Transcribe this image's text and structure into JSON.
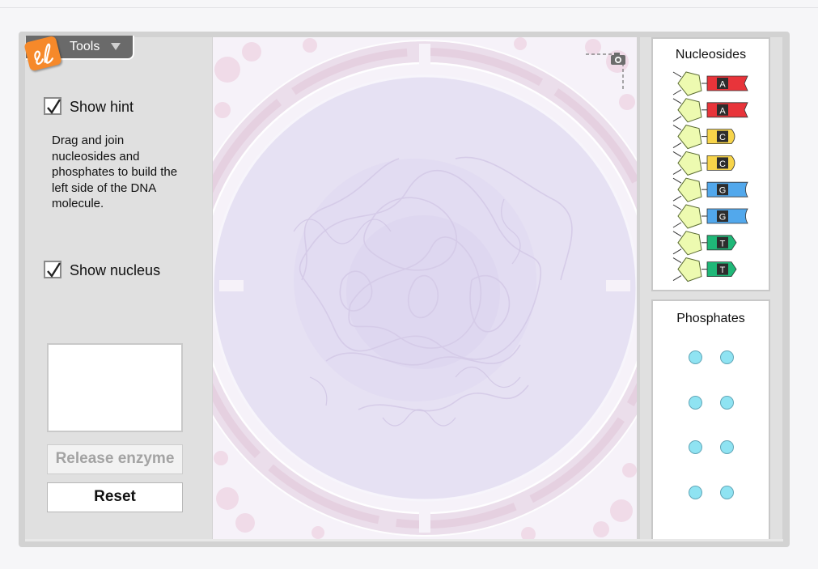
{
  "tools": {
    "label": "Tools"
  },
  "left_panel": {
    "show_hint_label": "Show hint",
    "show_hint_checked": true,
    "hint_text": "Drag and join nucleosides and phosphates to build the left side of the DNA molecule.",
    "show_nucleus_label": "Show nucleus",
    "show_nucleus_checked": true,
    "release_enzyme_label": "Release enzyme",
    "release_enzyme_enabled": false,
    "reset_label": "Reset"
  },
  "nucleosides": {
    "title": "Nucleosides",
    "items": [
      {
        "base": "A",
        "color": "#e8343a"
      },
      {
        "base": "A",
        "color": "#e8343a"
      },
      {
        "base": "C",
        "color": "#f7d44a"
      },
      {
        "base": "C",
        "color": "#f7d44a"
      },
      {
        "base": "G",
        "color": "#52a8ec"
      },
      {
        "base": "G",
        "color": "#52a8ec"
      },
      {
        "base": "T",
        "color": "#1fb878"
      },
      {
        "base": "T",
        "color": "#1fb878"
      }
    ],
    "sugar_color": "#edfab0"
  },
  "phosphates": {
    "title": "Phosphates",
    "count": 8,
    "color": "#8fe3f2"
  },
  "icons": {
    "logo": "explorelearning-logo-icon",
    "dropdown": "triangle-down-icon",
    "checkmark": "checkmark-icon",
    "camera": "camera-icon"
  }
}
